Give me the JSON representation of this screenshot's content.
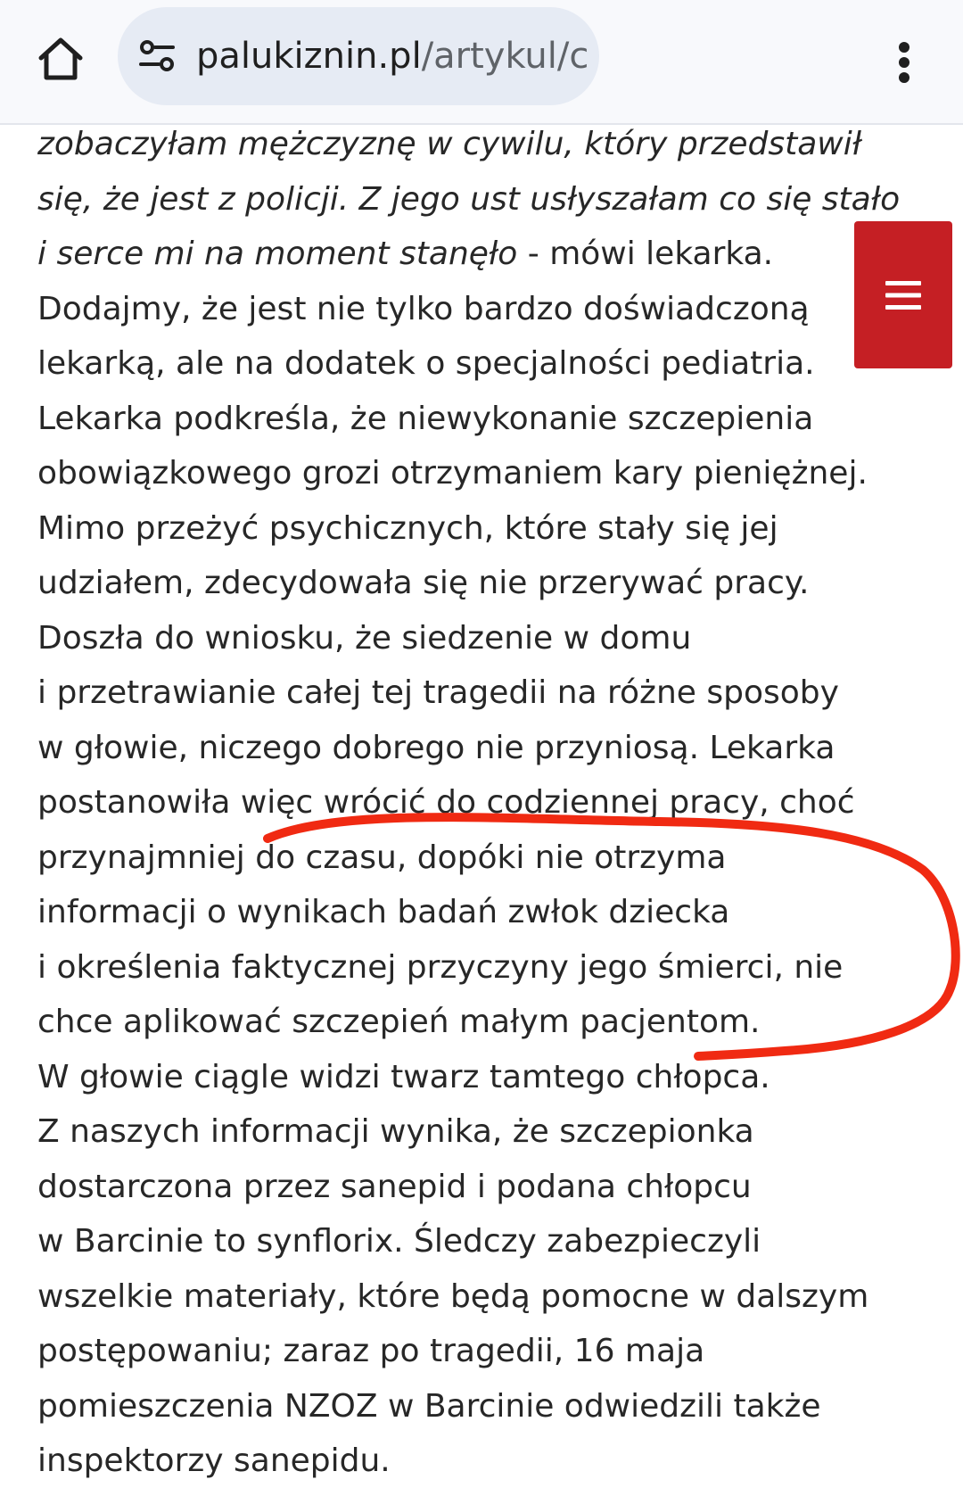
{
  "browser": {
    "url_domain": "palukiznin.pl",
    "url_path": "/artykul/c",
    "icons": {
      "home": "home-icon",
      "site_settings": "tune-icon",
      "menu": "more-vert-icon"
    }
  },
  "floating_menu": {
    "icon": "hamburger-menu-icon",
    "color": "#c51f24"
  },
  "annotation": {
    "type": "hand-drawn-bracket",
    "color": "#f02a12"
  },
  "article": {
    "lines": [
      {
        "italic": "zobaczyłam mężczyznę w cywilu, który przedstawił",
        "normal": ""
      },
      {
        "italic": "się, że jest z policji. Z jego ust usłyszałam co się stało",
        "normal": ""
      },
      {
        "italic": "i serce mi na moment stanęło",
        "normal": " - mówi lekarka."
      },
      {
        "italic": "",
        "normal": "Dodajmy, że jest nie tylko bardzo doświadczoną"
      },
      {
        "italic": "",
        "normal": "lekarką, ale na dodatek o specjalności pediatria."
      },
      {
        "italic": "",
        "normal": "Lekarka podkreśla, że niewykonanie szczepienia"
      },
      {
        "italic": "",
        "normal": "obowiązkowego grozi otrzymaniem kary pieniężnej."
      },
      {
        "italic": "",
        "normal": "Mimo przeżyć psychicznych, które stały się jej"
      },
      {
        "italic": "",
        "normal": "udziałem, zdecydowała się nie przerywać pracy."
      },
      {
        "italic": "",
        "normal": "Doszła do wniosku, że siedzenie w domu"
      },
      {
        "italic": "",
        "normal": "i przetrawianie całej tej tragedii na różne sposoby"
      },
      {
        "italic": "",
        "normal": "w głowie, niczego dobrego nie przyniosą. Lekarka"
      },
      {
        "italic": "",
        "normal": "postanowiła więc wrócić do codziennej pracy, choć"
      },
      {
        "italic": "",
        "normal": "przynajmniej do czasu, dopóki nie otrzyma"
      },
      {
        "italic": "",
        "normal": "informacji  o wynikach badań zwłok dziecka"
      },
      {
        "italic": "",
        "normal": "i określenia faktycznej przyczyny jego śmierci, nie"
      },
      {
        "italic": "",
        "normal": "chce aplikować szczepień małym pacjentom."
      },
      {
        "italic": "",
        "normal": "W głowie ciągle widzi twarz tamtego chłopca."
      },
      {
        "italic": "",
        "normal": "Z naszych informacji wynika, że szczepionka"
      },
      {
        "italic": "",
        "normal": "dostarczona przez sanepid i podana chłopcu"
      },
      {
        "italic": "",
        "normal": "w Barcinie to synflorix. Śledczy zabezpieczyli"
      },
      {
        "italic": "",
        "normal": "wszelkie materiały, które będą pomocne w dalszym"
      },
      {
        "italic": "",
        "normal": "postępowaniu; zaraz po tragedii, 16 maja"
      },
      {
        "italic": "",
        "normal": "pomieszczenia NZOZ w Barcinie odwiedzili także"
      },
      {
        "italic": "",
        "normal": "inspektorzy sanepidu."
      }
    ]
  }
}
